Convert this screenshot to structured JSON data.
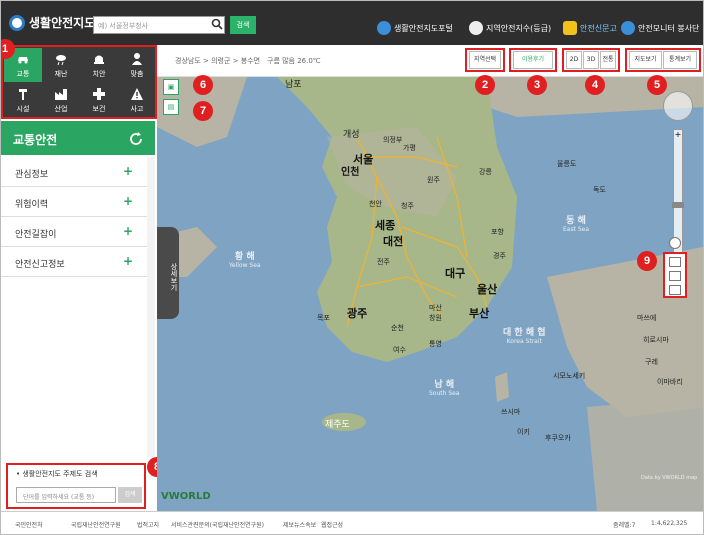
{
  "header": {
    "logo_text": "생활안전지도",
    "search_placeholder": "예) 서울정부청사",
    "search_button": "검색",
    "links": [
      "생활안전지도포털",
      "지역안전지수(등급)",
      "안전신문고",
      "안전모니터 봉사단"
    ]
  },
  "categories": [
    {
      "label": "교통",
      "icon": "car-icon",
      "active": true
    },
    {
      "label": "재난",
      "icon": "rain-cloud-icon"
    },
    {
      "label": "치안",
      "icon": "police-hat-icon"
    },
    {
      "label": "맞춤",
      "icon": "person-icon"
    },
    {
      "label": "시설",
      "icon": "tool-icon"
    },
    {
      "label": "산업",
      "icon": "factory-icon"
    },
    {
      "label": "보건",
      "icon": "health-icon"
    },
    {
      "label": "사고",
      "icon": "warning-icon"
    }
  ],
  "sidebar": {
    "section_title": "교통안전",
    "items": [
      "관심정보",
      "위험이력",
      "안전길잡이",
      "안전신고정보"
    ],
    "handle_label": "상세보기",
    "theme_search_title": "• 생활안전지도 주제도 검색",
    "theme_search_placeholder": "단어를 입력하세요 (교통 등)",
    "theme_search_button": "검색"
  },
  "toolbar": {
    "breadcrumb": "경상남도 > 의령군 > 봉수면",
    "weather": "구름 많음 26.0℃",
    "region_select": "지역선택",
    "share": "이용후기",
    "view_2d": "2D",
    "view_3d": "3D",
    "view_extra": "전통",
    "map_view": "지도보기",
    "stats_view": "통계보기"
  },
  "map": {
    "seas": [
      {
        "name": "황 해",
        "sub": "Yellow Sea"
      },
      {
        "name": "동 해",
        "sub": "East Sea"
      },
      {
        "name": "남 해",
        "sub": "South Sea"
      },
      {
        "name": "대 한 해 협",
        "sub": "Korea Strait"
      }
    ],
    "major_cities": [
      "서울",
      "인천",
      "세종",
      "대전",
      "대구",
      "울산",
      "광주",
      "부산"
    ],
    "minor_labels": [
      "남포",
      "개성",
      "의정부",
      "가평",
      "강릉",
      "천안",
      "청주",
      "원주",
      "전주",
      "경주",
      "포항",
      "목포",
      "순천",
      "창원",
      "마산",
      "통영",
      "여수",
      "제주도",
      "시모노세키",
      "후쿠오카",
      "마쓰에",
      "히로시마",
      "구레",
      "이마바리",
      "쓰시마",
      "이키",
      "독도",
      "울릉도"
    ],
    "attribution": "Data by VWORLD map",
    "world_logo": "VWORLD"
  },
  "badges": [
    "6",
    "7",
    "8",
    "9",
    "2",
    "3",
    "4",
    "5"
  ],
  "footer": {
    "items": [
      "국민안전처",
      "국립재난안전연구원",
      "법적고지",
      "서비스관련문의(국립재난안전연구원)",
      "제보뉴스속보",
      "웹접근성"
    ],
    "zoom_level": "줌레벨:7",
    "scale": "1:4,622,325"
  },
  "colors": {
    "accent_green": "#2aa662",
    "header_dark": "#2e2e2e",
    "highlight_red": "#e02020"
  }
}
